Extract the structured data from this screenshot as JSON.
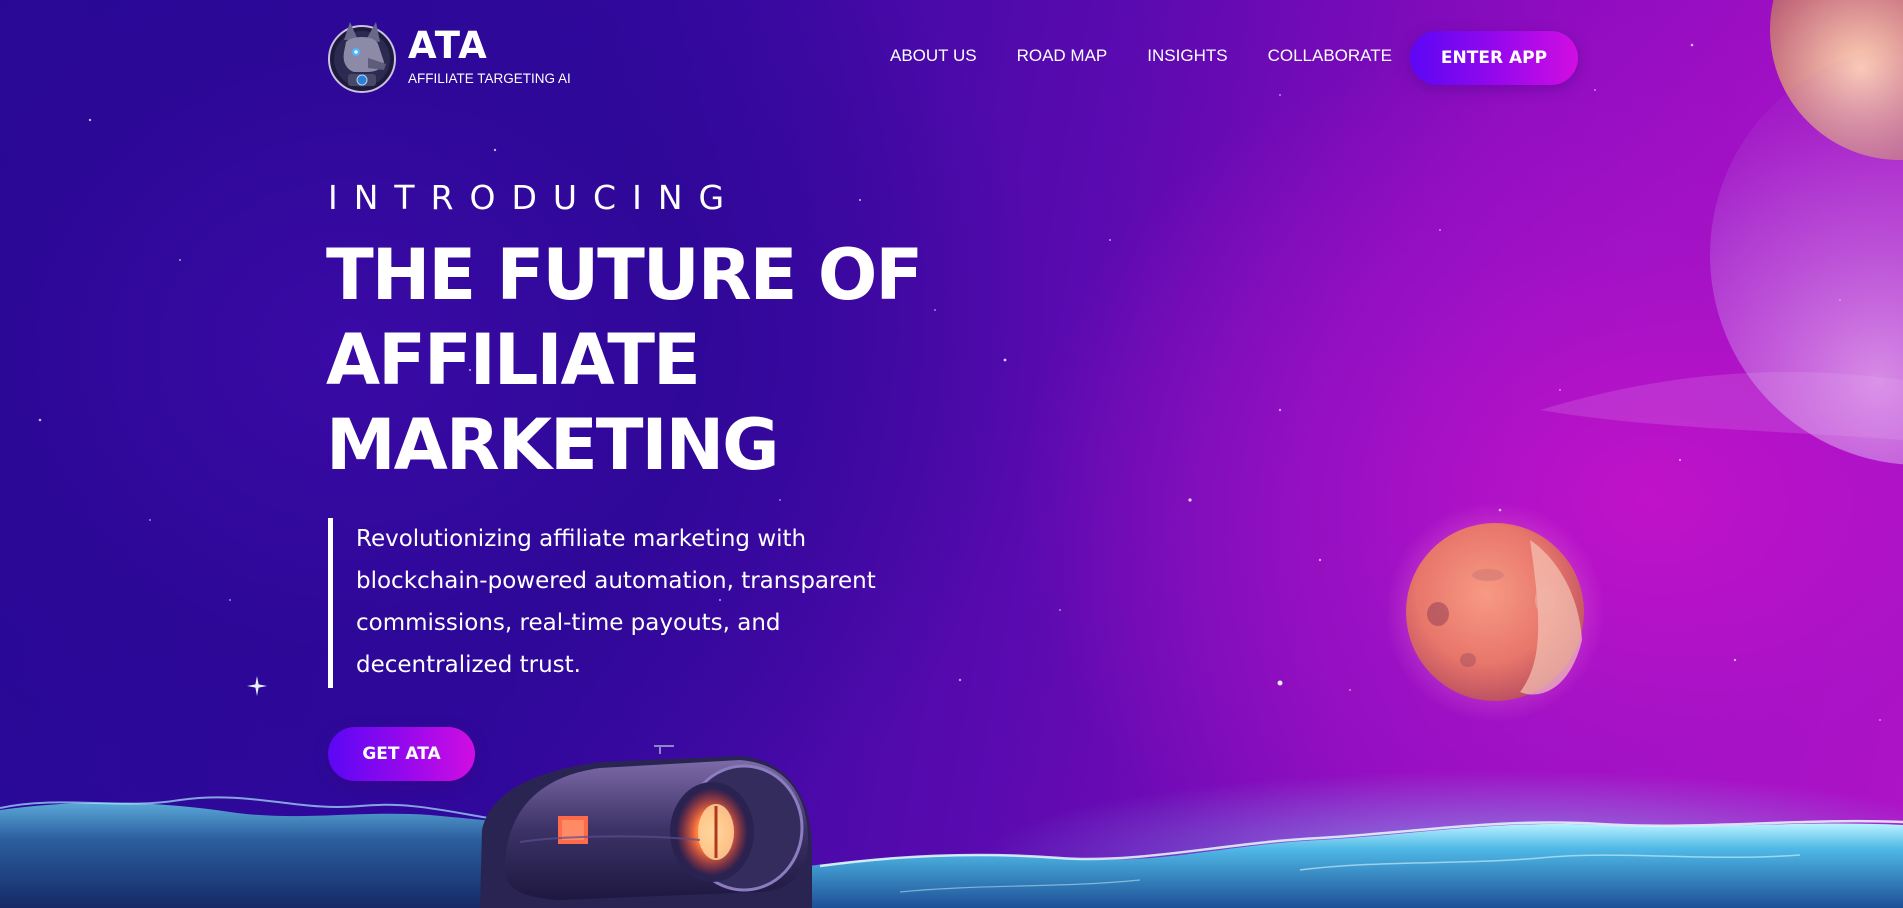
{
  "brand": {
    "name": "ATA",
    "subtitle": "AFFILIATE TARGETING AI",
    "logo_icon": "robot-dog-icon"
  },
  "nav": {
    "links": [
      "ABOUT US",
      "ROAD MAP",
      "INSIGHTS",
      "COLLABORATE"
    ],
    "cta_label": "ENTER APP"
  },
  "hero": {
    "eyebrow": "INTRODUCING",
    "headline_lines": [
      "THE FUTURE OF",
      "AFFILIATE",
      "MARKETING"
    ],
    "tagline_lines": [
      "Revolutionizing affiliate marketing with",
      "blockchain-powered automation, transparent",
      "commissions, real-time payouts, and",
      "decentralized trust."
    ],
    "cta_label": "GET ATA"
  },
  "colors": {
    "bg_deep": "#260a96",
    "bg_magenta": "#b012c6",
    "button_start": "#5b07f5",
    "button_end": "#d10ee1",
    "text": "#ffffff"
  }
}
